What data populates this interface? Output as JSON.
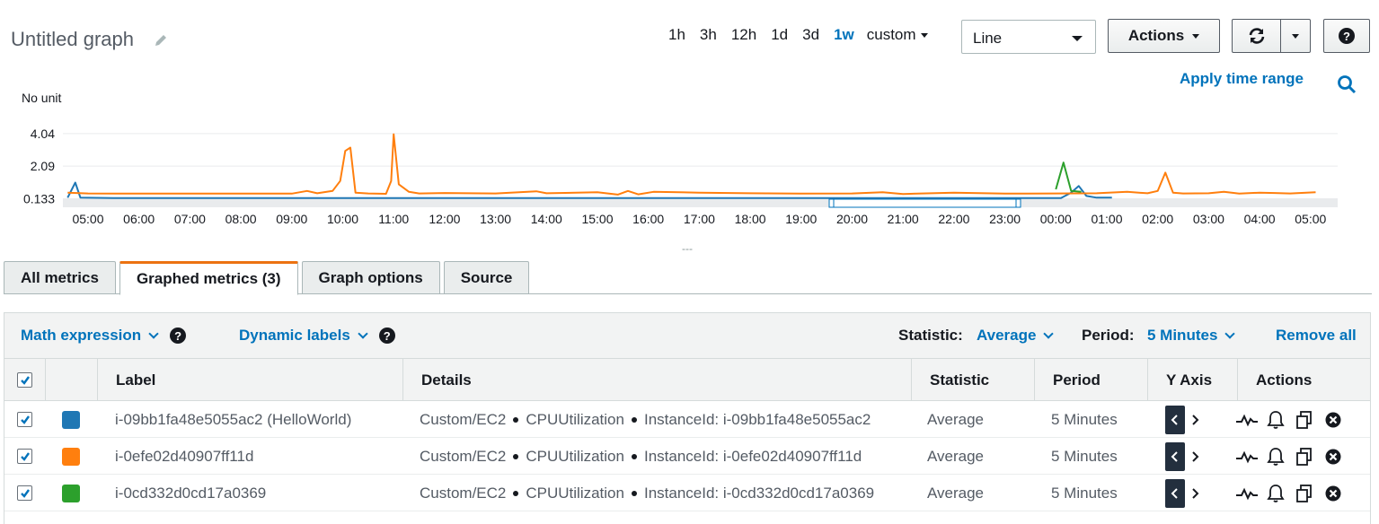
{
  "header": {
    "title": "Untitled graph",
    "time_ranges": [
      "1h",
      "3h",
      "12h",
      "1d",
      "3d",
      "1w"
    ],
    "active_range": "1w",
    "custom_label": "custom",
    "view_type": "Line",
    "actions_label": "Actions",
    "apply_time_range": "Apply time range"
  },
  "chart_data": {
    "type": "line",
    "unit_label": "No unit",
    "y_ticks": [
      "4.04",
      "2.09",
      "0.133"
    ],
    "ylim": [
      0,
      4.3
    ],
    "x_ticks": [
      "05:00",
      "06:00",
      "07:00",
      "08:00",
      "09:00",
      "10:00",
      "11:00",
      "12:00",
      "13:00",
      "14:00",
      "15:00",
      "16:00",
      "17:00",
      "18:00",
      "19:00",
      "20:00",
      "21:00",
      "22:00",
      "23:00",
      "00:00",
      "01:00",
      "02:00",
      "03:00",
      "04:00",
      "05:00"
    ],
    "series": [
      {
        "name": "i-09bb1fa48e5055ac2 (HelloWorld)",
        "color": "#1f77b4",
        "points": [
          [
            4.6,
            0.2
          ],
          [
            4.75,
            1.1
          ],
          [
            4.85,
            0.2
          ],
          [
            5.5,
            0.18
          ],
          [
            10,
            0.18
          ],
          [
            15,
            0.18
          ],
          [
            20,
            0.18
          ],
          [
            24.1,
            0.18
          ],
          [
            24.3,
            0.5
          ],
          [
            24.45,
            0.9
          ],
          [
            24.6,
            0.3
          ],
          [
            24.8,
            0.2
          ],
          [
            25.1,
            0.2
          ]
        ]
      },
      {
        "name": "i-0efe02d40907ff11d",
        "color": "#ff7f0e",
        "points": [
          [
            4.6,
            0.5
          ],
          [
            5,
            0.45
          ],
          [
            6,
            0.44
          ],
          [
            7,
            0.44
          ],
          [
            8,
            0.44
          ],
          [
            9,
            0.44
          ],
          [
            9.3,
            0.6
          ],
          [
            9.5,
            0.46
          ],
          [
            9.8,
            0.6
          ],
          [
            9.95,
            1.2
          ],
          [
            10.05,
            3.0
          ],
          [
            10.15,
            3.2
          ],
          [
            10.25,
            0.5
          ],
          [
            10.5,
            0.45
          ],
          [
            10.85,
            0.43
          ],
          [
            10.95,
            1.2
          ],
          [
            11.0,
            4.0
          ],
          [
            11.1,
            1.0
          ],
          [
            11.3,
            0.55
          ],
          [
            11.5,
            0.45
          ],
          [
            12,
            0.48
          ],
          [
            13,
            0.45
          ],
          [
            13.8,
            0.58
          ],
          [
            14,
            0.46
          ],
          [
            15,
            0.52
          ],
          [
            15.4,
            0.38
          ],
          [
            15.6,
            0.6
          ],
          [
            15.8,
            0.4
          ],
          [
            16.1,
            0.55
          ],
          [
            17,
            0.5
          ],
          [
            18,
            0.46
          ],
          [
            19,
            0.44
          ],
          [
            20,
            0.45
          ],
          [
            20.6,
            0.52
          ],
          [
            21,
            0.42
          ],
          [
            22,
            0.5
          ],
          [
            23,
            0.44
          ],
          [
            24,
            0.45
          ],
          [
            24.8,
            0.46
          ],
          [
            25.4,
            0.55
          ],
          [
            25.8,
            0.46
          ],
          [
            26.0,
            0.6
          ],
          [
            26.15,
            1.7
          ],
          [
            26.3,
            0.5
          ],
          [
            26.5,
            0.45
          ],
          [
            27,
            0.46
          ],
          [
            27.3,
            0.55
          ],
          [
            27.6,
            0.44
          ],
          [
            28,
            0.5
          ],
          [
            28.3,
            0.48
          ],
          [
            28.6,
            0.45
          ],
          [
            29.1,
            0.52
          ]
        ]
      },
      {
        "name": "i-0cd332d0cd17a0369",
        "color": "#2ca02c",
        "points": [
          [
            24.0,
            0.7
          ],
          [
            24.15,
            2.3
          ],
          [
            24.3,
            0.6
          ],
          [
            24.5,
            0.55
          ]
        ]
      }
    ]
  },
  "tabs": [
    "All metrics",
    "Graphed metrics (3)",
    "Graph options",
    "Source"
  ],
  "active_tab": "Graphed metrics (3)",
  "toolbar": {
    "math_expression": "Math expression",
    "dynamic_labels": "Dynamic labels",
    "statistic_label": "Statistic:",
    "statistic_value": "Average",
    "period_label": "Period:",
    "period_value": "5 Minutes",
    "remove_all": "Remove all"
  },
  "table": {
    "columns": [
      "Label",
      "Details",
      "Statistic",
      "Period",
      "Y Axis",
      "Actions"
    ],
    "rows": [
      {
        "color": "#1f77b4",
        "label": "i-09bb1fa48e5055ac2 (HelloWorld)",
        "namespace": "Custom/EC2",
        "metric": "CPUUtilization",
        "dimension": "InstanceId: i-09bb1fa48e5055ac2",
        "statistic": "Average",
        "period": "5 Minutes"
      },
      {
        "color": "#ff7f0e",
        "label": "i-0efe02d40907ff11d",
        "namespace": "Custom/EC2",
        "metric": "CPUUtilization",
        "dimension": "InstanceId: i-0efe02d40907ff11d",
        "statistic": "Average",
        "period": "5 Minutes"
      },
      {
        "color": "#2ca02c",
        "label": "i-0cd332d0cd17a0369",
        "namespace": "Custom/EC2",
        "metric": "CPUUtilization",
        "dimension": "InstanceId: i-0cd332d0cd17a0369",
        "statistic": "Average",
        "period": "5 Minutes"
      }
    ]
  }
}
